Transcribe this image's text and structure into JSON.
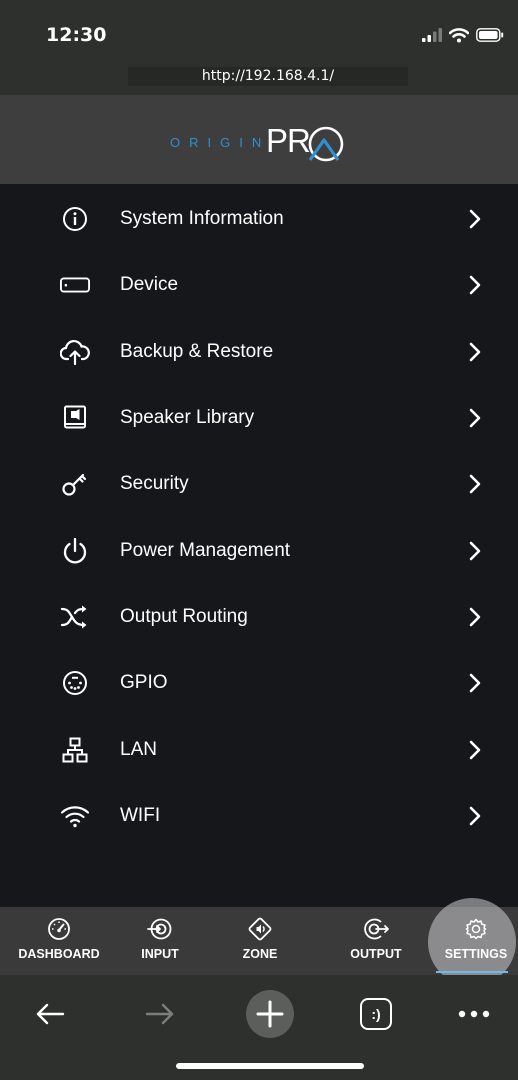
{
  "status_bar": {
    "time": "12:30"
  },
  "browser": {
    "url": "http://192.168.4.1/",
    "tab_button_label": ":)"
  },
  "header": {
    "logo_text": "ORIGIN",
    "logo_mark": "PRO",
    "accent": "#2f8fd1"
  },
  "settings_menu": {
    "items": [
      {
        "label": "System Information",
        "icon": "info-icon"
      },
      {
        "label": "Device",
        "icon": "device-icon"
      },
      {
        "label": "Backup & Restore",
        "icon": "cloud-upload-icon"
      },
      {
        "label": "Speaker Library",
        "icon": "speaker-library-icon"
      },
      {
        "label": "Security",
        "icon": "key-icon"
      },
      {
        "label": "Power Management",
        "icon": "power-icon"
      },
      {
        "label": "Output Routing",
        "icon": "shuffle-icon"
      },
      {
        "label": "GPIO",
        "icon": "gpio-icon"
      },
      {
        "label": "LAN",
        "icon": "network-icon"
      },
      {
        "label": "WIFI",
        "icon": "wifi-icon"
      }
    ]
  },
  "tab_bar": {
    "tabs": [
      {
        "label": "DASHBOARD",
        "icon": "gauge-icon"
      },
      {
        "label": "INPUT",
        "icon": "input-icon"
      },
      {
        "label": "ZONE",
        "icon": "zone-icon"
      },
      {
        "label": "OUTPUT",
        "icon": "output-icon"
      },
      {
        "label": "SETTINGS",
        "icon": "gear-icon",
        "active": true
      }
    ]
  }
}
